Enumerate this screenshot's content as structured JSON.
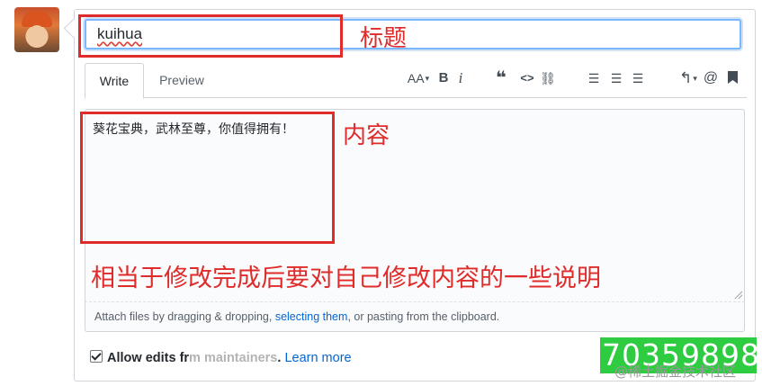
{
  "form": {
    "title_value": "kuihua",
    "tabs": [
      "Write",
      "Preview"
    ],
    "toolbar": {
      "text_size": "AA",
      "bold": "B",
      "italic": "i",
      "quote": "❝",
      "code": "<>",
      "link": "⛓",
      "bullet_list": "☰",
      "numbered_list": "☰",
      "task_list": "☰",
      "reply": "↰",
      "mention": "@",
      "bookmark": "🔖"
    },
    "body_value": "葵花宝典，武林至尊，你值得拥有！",
    "attach": {
      "prefix": "Attach files by dragging & dropping, ",
      "link": "selecting them",
      "suffix": ", or pasting from the clipboard."
    },
    "allow_edits": {
      "label": "Allow edits fr",
      "obscured": "m maintainers",
      "more": "Learn more"
    }
  },
  "annotations": {
    "title_label": "标题",
    "content_label": "内容",
    "note": "相当于修改完成后要对自己修改内容的一些说明"
  },
  "overlay": {
    "green_number": "70359898",
    "watermark": "@稀土掘金技术社区"
  }
}
